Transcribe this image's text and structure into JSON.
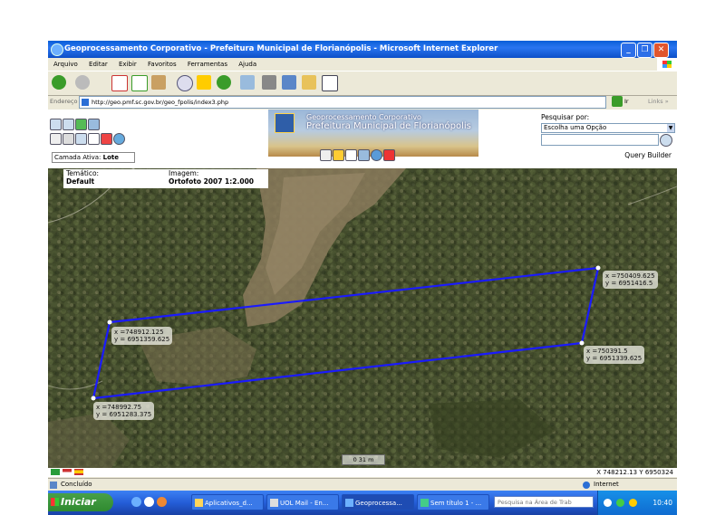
{
  "window": {
    "title": "Geoprocessamento Corporativo - Prefeitura Municipal de Florianópolis - Microsoft Internet Explorer",
    "min": "_",
    "max": "❐",
    "close": "✕"
  },
  "menu": [
    "Arquivo",
    "Editar",
    "Exibir",
    "Favoritos",
    "Ferramentas",
    "Ajuda"
  ],
  "address": {
    "label": "Endereço",
    "url": "http://geo.pmf.sc.gov.br/geo_fpolis/index3.php",
    "go": "Ir",
    "links": "Links »"
  },
  "app": {
    "title_line1": "Geoprocessamento Corporativo",
    "title_line2": "Prefeitura Municipal de Florianópolis",
    "active_layer_label": "Camada Ativa:",
    "active_layer_value": "Lote",
    "search_label": "Pesquisar por:",
    "search_select": "Escolha uma Opção",
    "query_builder": "Query Builder"
  },
  "info": {
    "tematico_label": "Temático:",
    "tematico_value": "Default",
    "imagem_label": "Imagem:",
    "imagem_value": "Ortofoto 2007 1:2.000"
  },
  "map": {
    "points": [
      {
        "label": "x =748912.125\ny = 6951359.625"
      },
      {
        "label": "x =750409.625\ny = 6951416.5"
      },
      {
        "label": "x =750391.5\ny = 6951339.625"
      },
      {
        "label": "x =748992.75\ny = 6951283.375"
      }
    ],
    "scale": "0    31 m",
    "cursor_coords": "X 748212.13 Y 6950324",
    "line_color": "#1a1aff"
  },
  "status": {
    "text": "Concluído",
    "zone": "Internet"
  },
  "taskbar": {
    "start": "Iniciar",
    "tasks": [
      "Aplicativos_d...",
      "UOL Mail - En...",
      "Geoprocessa...",
      "Sem título 1 - ..."
    ],
    "search_placeholder": "Pesquisa na Área de Trab",
    "clock": "10:40"
  }
}
